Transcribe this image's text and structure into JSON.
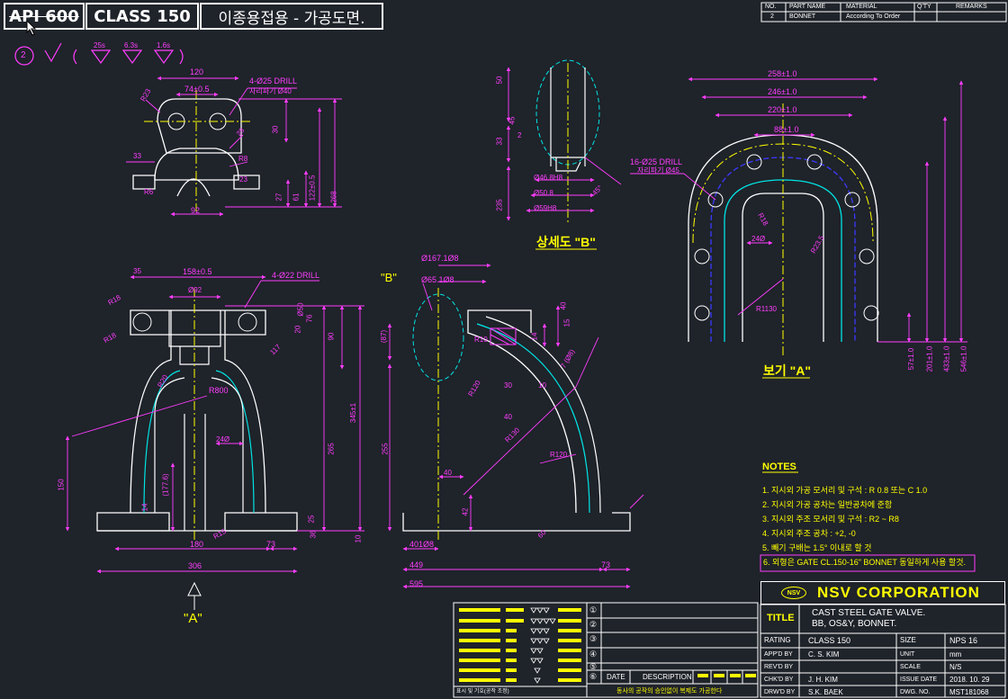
{
  "header": {
    "api_label": "API 600",
    "class_label": "CLASS 150",
    "title_kr": "이종용접용 - 가공도면."
  },
  "parts_list": {
    "headers": [
      "NO.",
      "PART NAME",
      "MATERIAL",
      "Q'TY",
      "REMARKS"
    ],
    "row": [
      "2",
      "BONNET",
      "According To Order",
      "",
      ""
    ]
  },
  "symbols": {
    "circle_num": "2",
    "roughness": [
      "25s",
      "6.3s",
      "1.6s"
    ]
  },
  "dims_top_left": [
    "120",
    "74±0.5",
    "4-Ø25 DRILL",
    "자리파기 Ø40",
    "R23",
    "28",
    "R8",
    "33",
    "R6",
    "27",
    "61",
    "122±0.5",
    "268",
    "92",
    "30",
    "23"
  ],
  "dims_detail_b": [
    "50",
    "45",
    "33",
    "2",
    "Ø46.8H8",
    "Ø50.8",
    "Ø59H8",
    "235",
    "45°"
  ],
  "detail_b_label": "상세도 \"B\"",
  "dims_view_a": [
    "258±1.0",
    "246±1.0",
    "220±1.0",
    "88±1.0",
    "16-Ø25 DRILL",
    "자리파기 Ø45",
    "R18",
    "R23.5",
    "24Ø",
    "R1130",
    "57±1.0",
    "201±1.0",
    "433±1.0",
    "546±1.0"
  ],
  "view_a_label": "보기 \"A\"",
  "dims_front": [
    "35",
    "158±0.5",
    "4-Ø22 DRILL",
    "R18",
    "Ø92",
    "Ø50",
    "20",
    "76",
    "90",
    "R18",
    "R20",
    "117",
    "R800",
    "345±1",
    "24Ø",
    "150",
    "(177.6)",
    "14",
    "265",
    "R15",
    "180",
    "73",
    "306",
    "25",
    "10",
    "36"
  ],
  "front_arrow_label": "\"A\"",
  "dims_section": [
    "Ø167.1Ø8",
    "Ø65.1Ø8",
    "(87)",
    "R10",
    "R120",
    "14",
    "10",
    "30",
    "15",
    "40",
    "7 (Ø8)",
    "40",
    "R130",
    "R120",
    "40",
    "42",
    "60",
    "255",
    "401Ø8",
    "449",
    "595",
    "73"
  ],
  "section_b_label": "\"B\"",
  "notes": {
    "title": "NOTES",
    "items": [
      "1. 지시외 가공 모서리 및 구석 : R 0.8 또는 C 1.0",
      "2. 지시외 가공 공차는 일반공차에 준함",
      "3. 지시외 주조 모서리 및 구석 : R2 ~ R8",
      "4. 지시외 주조 공차 : +2, -0",
      "5. 빼기 구배는 1.5° 이내로 할 것",
      "6. 외형은 GATE CL.150-16\" BONNET 동일하게 사용 할것."
    ]
  },
  "revision": {
    "date_label": "DATE",
    "desc_label": "DESCRIPTION",
    "footer_note": "동사의 공작의 승인없이 복제도 가공한다",
    "left_footer": "표시 및 기호(공작 조정)",
    "marks": [
      "①",
      "②",
      "③",
      "④",
      "⑤",
      "⑥"
    ]
  },
  "title_block": {
    "company": "NSV CORPORATION",
    "logo": "NSV",
    "title_label": "TITLE",
    "title_line1": "CAST STEEL GATE VALVE.",
    "title_line2": "BB, OS&Y, BONNET.",
    "rating_label": "RATING",
    "rating": "CLASS 150",
    "size_label": "SIZE",
    "size": "NPS 16",
    "appd_label": "APP'D BY",
    "appd": "C. S. KIM",
    "unit_label": "UNIT",
    "unit": "mm",
    "revd_label": "REV'D BY",
    "scale_label": "SCALE",
    "scale": "N/S",
    "chkd_label": "CHK'D BY",
    "chkd": "J. H. KIM",
    "issue_label": "ISSUE DATE",
    "issue": "2018. 10. 29",
    "drwd_label": "DRW'D BY",
    "drwd": "S.K. BAEK",
    "dwg_label": "DWG. NO.",
    "dwg": "MST181068"
  },
  "colors": {
    "background": "#1f232a",
    "dimension": "#ff3dff",
    "outline": "#ffffff",
    "centerline": "#ffff00",
    "hidden": "#3b3bff",
    "detail": "#00e5e5",
    "text_highlight": "#ffff00"
  }
}
